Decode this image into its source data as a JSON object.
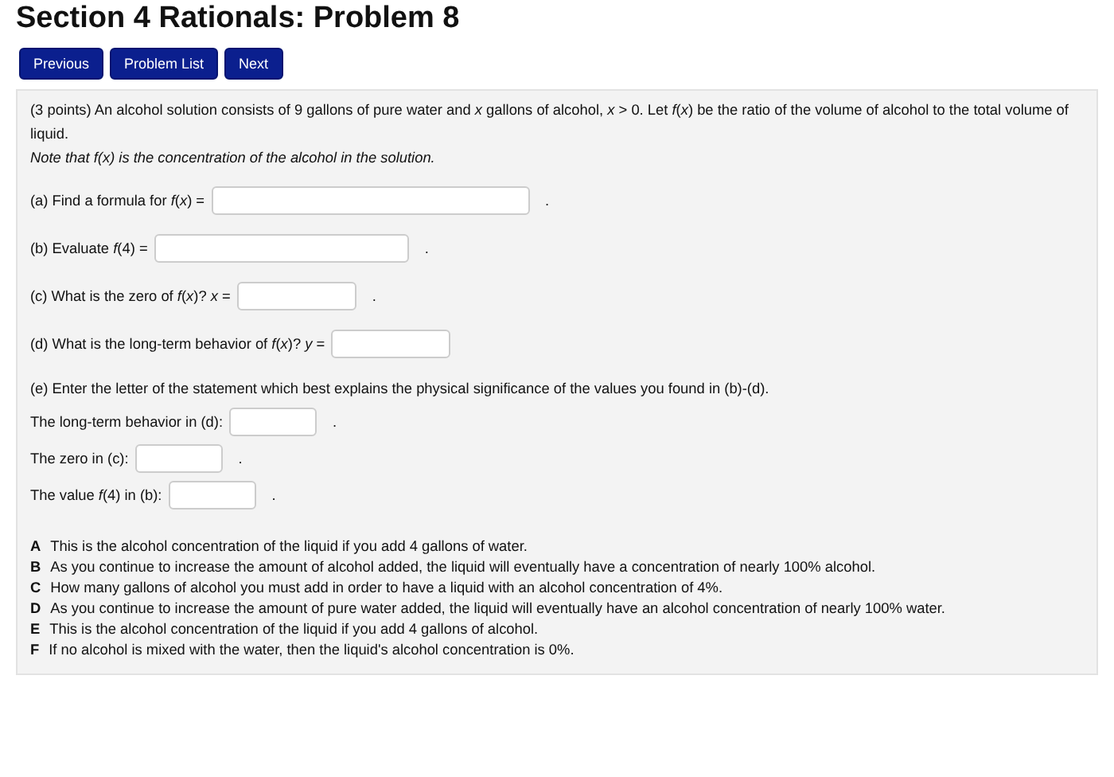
{
  "title": "Section 4 Rationals: Problem 8",
  "nav_buttons": [
    "Previous",
    "Problem List",
    "Next"
  ],
  "problem": {
    "intro": "(3 points) An alcohol solution consists of 9 gallons of pure water and *x* gallons of alcohol, *x* > 0. Let *f*(*x*) be the ratio of the volume of alcohol to the total volume of liquid.",
    "note": "Note that *f*(*x*) is the concentration of the alcohol in the solution."
  },
  "parts": [
    {
      "label": "(a) Find a formula for  *f*(*x*) =",
      "after": "."
    },
    {
      "label": "(b) Evaluate  *f*(4) =",
      "after": "."
    },
    {
      "label": "(c) What is the zero of *f*(*x*)?  *x* =",
      "after": "."
    },
    {
      "label": "(d) What is the long-term behavior of *f*(*x*)?  *y* ="
    }
  ],
  "part_e": {
    "intro": "(e) Enter the letter of the statement which best explains the physical significance of the values you found in (b)-(d).",
    "items": [
      {
        "label": "The long-term behavior in (d):",
        "after": "."
      },
      {
        "label": "The zero in (c):",
        "after": "."
      },
      {
        "label": "The value *f*(4) in (b):",
        "after": "."
      }
    ]
  },
  "options": [
    {
      "letter": "A",
      "text": "This is the alcohol concentration of the liquid if you add 4 gallons of water."
    },
    {
      "letter": "B",
      "text": "As you continue to increase the amount of alcohol added, the liquid will eventually have a concentration of nearly 100% alcohol."
    },
    {
      "letter": "C",
      "text": "How many gallons of alcohol you must add in order to have a liquid with an alcohol concentration of 4%."
    },
    {
      "letter": "D",
      "text": "As you continue to increase the amount of pure water added, the liquid will eventually have an alcohol concentration of nearly 100% water."
    },
    {
      "letter": "E",
      "text": "This is the alcohol concentration of the liquid if you add 4 gallons of alcohol."
    },
    {
      "letter": "F",
      "text": "If no alcohol is mixed with the water, then the liquid's alcohol concentration is 0%."
    }
  ]
}
